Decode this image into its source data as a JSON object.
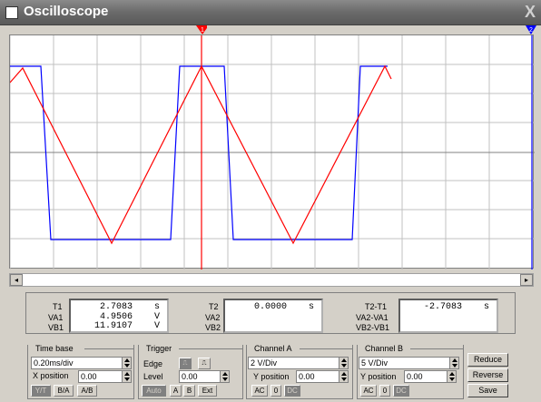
{
  "window": {
    "title": "Oscilloscope",
    "close_label": "X"
  },
  "cursors": {
    "t1_marker": "1",
    "t2_marker": "2"
  },
  "readout": {
    "t1": {
      "label": "T1",
      "value": "2.7083",
      "unit": "s"
    },
    "va1": {
      "label": "VA1",
      "value": "4.9506",
      "unit": "V"
    },
    "vb1": {
      "label": "VB1",
      "value": "11.9107",
      "unit": "V"
    },
    "t2": {
      "label": "T2",
      "value": "0.0000",
      "unit": "s"
    },
    "va2": {
      "label": "VA2"
    },
    "vb2": {
      "label": "VB2"
    },
    "dt": {
      "label": "T2-T1",
      "value": "-2.7083",
      "unit": "s"
    },
    "dva": {
      "label": "VA2-VA1"
    },
    "dvb": {
      "label": "VB2-VB1"
    }
  },
  "timebase": {
    "title": "Time base",
    "scale": "0.20ms/div",
    "xpos_label": "X position",
    "xpos": "0.00",
    "btn_yt": "Y/T",
    "btn_ba": "B/A",
    "btn_ab": "A/B"
  },
  "trigger": {
    "title": "Trigger",
    "edge_label": "Edge",
    "level_label": "Level",
    "level": "0.00",
    "btn_auto": "Auto",
    "btn_a": "A",
    "btn_b": "B",
    "btn_ext": "Ext"
  },
  "channel_a": {
    "title": "Channel A",
    "scale": "2 V/Div",
    "ypos_label": "Y position",
    "ypos": "0.00",
    "btn_ac": "AC",
    "btn_0": "0",
    "btn_dc": "DC"
  },
  "channel_b": {
    "title": "Channel B",
    "scale": "5 V/Div",
    "ypos_label": "Y position",
    "ypos": "0.00",
    "btn_ac": "AC",
    "btn_0": "0",
    "btn_dc": "DC"
  },
  "actions": {
    "reduce": "Reduce",
    "reverse": "Reverse",
    "save": "Save"
  },
  "colors": {
    "channel_a_trace": "#ff0000",
    "channel_b_trace": "#0000ff",
    "grid": "#c0c0c0",
    "cursor1": "#ff0000",
    "cursor2": "#0000ff"
  }
}
